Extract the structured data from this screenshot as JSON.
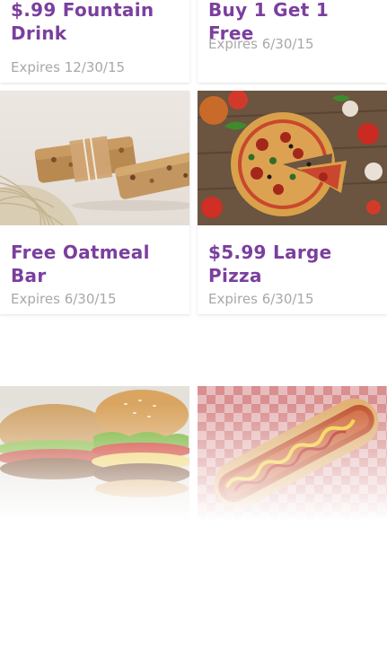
{
  "coupons": [
    {
      "title": "$.99 Fountain Drink",
      "expires": "Expires 12/30/15"
    },
    {
      "title": "Buy 1 Get 1 Free",
      "expires": "Expires 6/30/15"
    },
    {
      "title": "Free Oatmeal Bar",
      "expires": "Expires 6/30/15",
      "image": "oatmeal-bar-photo"
    },
    {
      "title": "$5.99 Large Pizza",
      "expires": "Expires 6/30/15",
      "image": "pizza-photo"
    },
    {
      "image": "burger-photo"
    },
    {
      "image": "hotdog-photo"
    }
  ],
  "colors": {
    "title": "#7b3f9e",
    "expiry": "#a8a8a8",
    "card_shadow": "#e6e6e6"
  }
}
